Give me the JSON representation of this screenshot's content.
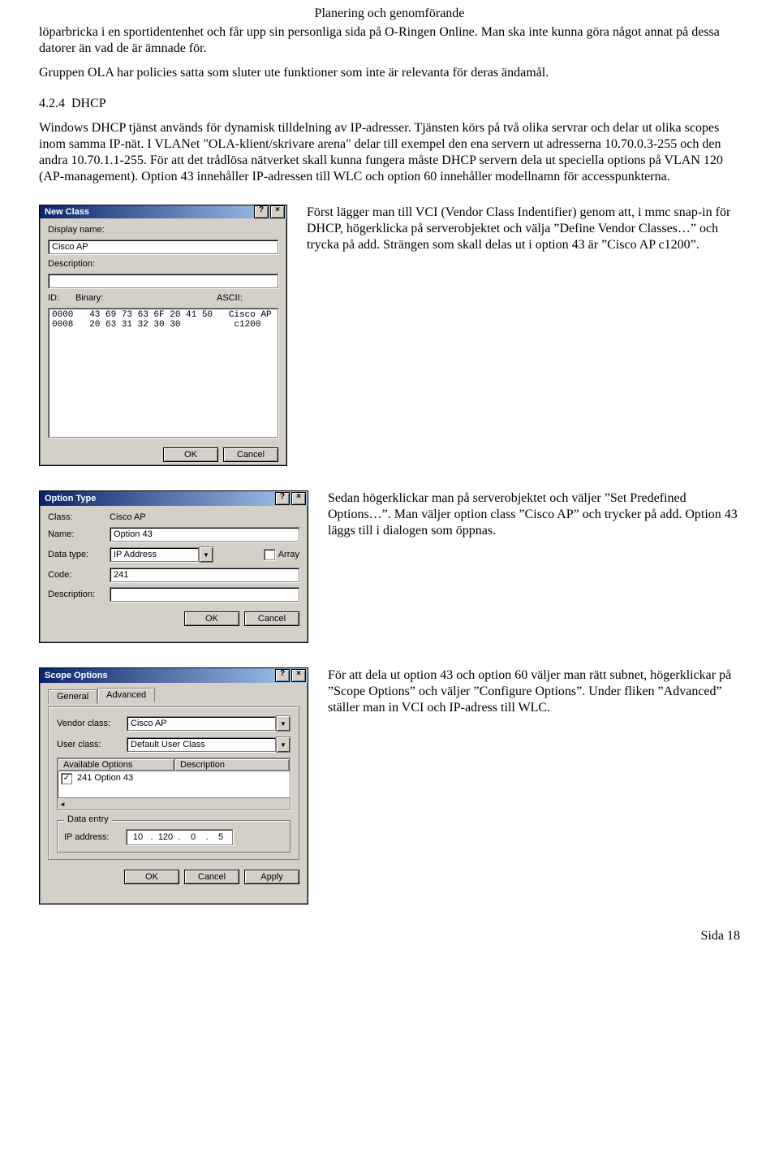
{
  "page": {
    "header": "Planering och genomförande",
    "footer": "Sida 18"
  },
  "body": {
    "p1": "löparbricka i en sportidentenhet och får upp sin personliga sida på O-Ringen Online. Man ska inte kunna göra något annat på dessa datorer än vad de är ämnade för.",
    "p2": "Gruppen OLA har policies satta som sluter ute funktioner som inte är relevanta för deras ändamål.",
    "section_no": "4.2.4",
    "section_title": "DHCP",
    "p3": "Windows DHCP tjänst används för dynamisk tilldelning av IP-adresser. Tjänsten körs på två olika servrar och delar ut olika scopes inom samma IP-nät. I VLANet \"OLA-klient/skrivare arena\" delar till exempel den ena servern ut adresserna 10.70.0.3-255 och den andra 10.70.1.1-255. För att det trådlösa nätverket skall kunna fungera måste DHCP servern dela ut speciella options på VLAN 120 (AP-management). Option 43 innehåller IP-adressen till WLC och option 60 innehåller modellnamn för accesspunkterna."
  },
  "captions": {
    "c1": "Först lägger man till VCI (Vendor Class Indentifier) genom att, i mmc snap-in för DHCP, högerklicka på serverobjektet och välja ”Define Vendor Classes…” och trycka på add. Strängen som skall delas ut i option 43 är ”Cisco AP c1200”.",
    "c2": "Sedan högerklickar man på serverobjektet och väljer ”Set Predefined Options…”. Man väljer option class ”Cisco AP” och trycker på add. Option 43 läggs till i dialogen som öppnas.",
    "c3": "För att dela ut option 43 och option 60 väljer man rätt subnet, högerklickar på ”Scope Options” och väljer ”Configure Options”. Under fliken ”Advanced” ställer man in VCI och IP-adress till WLC."
  },
  "dlg1": {
    "title": "New Class",
    "display_name_label": "Display name:",
    "display_name_value": "Cisco AP",
    "description_label": "Description:",
    "description_value": "",
    "id_label": "ID:",
    "binary_label": "Binary:",
    "ascii_label": "ASCII:",
    "hex_line1": "0000   43 69 73 63 6F 20 41 50   Cisco AP",
    "hex_line2": "0008   20 63 31 32 30 30          c1200",
    "ok": "OK",
    "cancel": "Cancel"
  },
  "dlg2": {
    "title": "Option Type",
    "class_label": "Class:",
    "class_value": "Cisco AP",
    "name_label": "Name:",
    "name_value": "Option 43",
    "datatype_label": "Data type:",
    "datatype_value": "IP Address",
    "array_label": "Array",
    "code_label": "Code:",
    "code_value": "241",
    "description_label": "Description:",
    "description_value": "",
    "ok": "OK",
    "cancel": "Cancel"
  },
  "dlg3": {
    "title": "Scope Options",
    "tab_general": "General",
    "tab_advanced": "Advanced",
    "vendor_label": "Vendor class:",
    "vendor_value": "Cisco AP",
    "user_label": "User class:",
    "user_value": "Default User Class",
    "col_available": "Available Options",
    "col_description": "Description",
    "opt_row": "241 Option 43",
    "data_entry_legend": "Data entry",
    "ip_label": "IP address:",
    "ip_oct1": "10",
    "ip_oct2": "120",
    "ip_oct3": "0",
    "ip_oct4": "5",
    "ok": "OK",
    "cancel": "Cancel",
    "apply": "Apply"
  }
}
